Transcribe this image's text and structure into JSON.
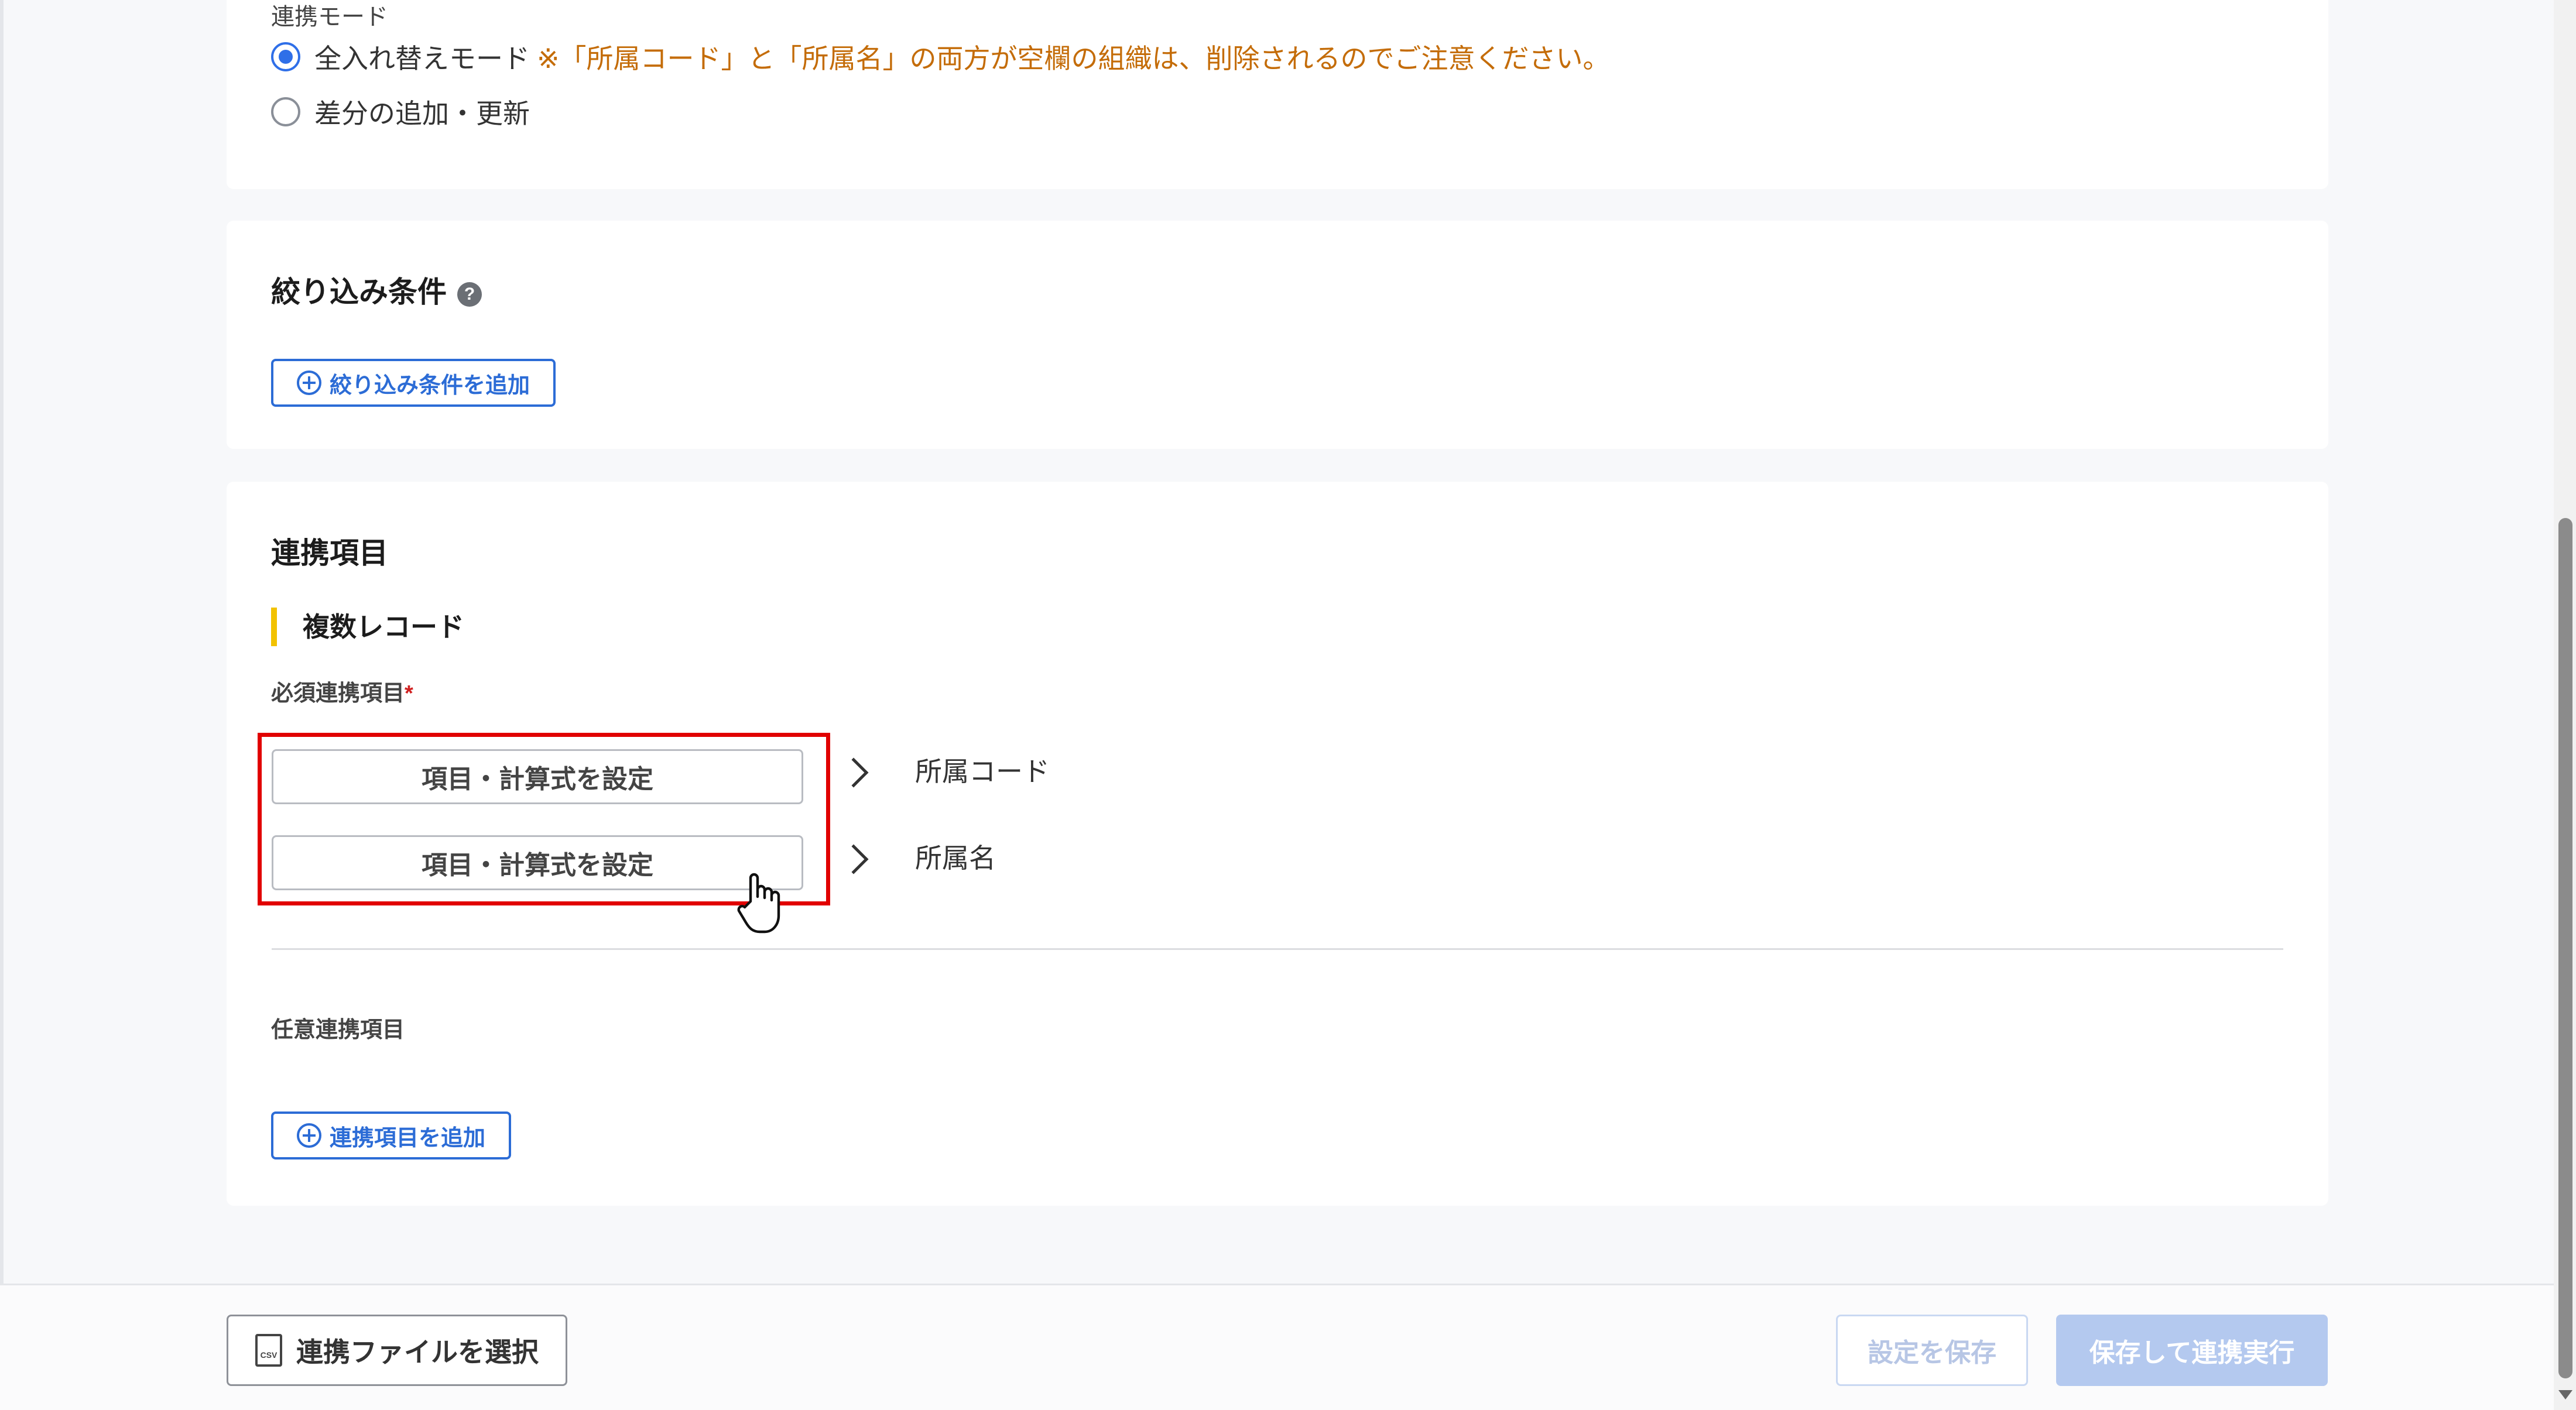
{
  "mode_section": {
    "title": "連携モード",
    "options": [
      {
        "label": "全入れ替えモード",
        "note": "※「所属コード」と「所属名」の両方が空欄の組織は、削除されるのでご注意ください。",
        "checked": true
      },
      {
        "label": "差分の追加・更新",
        "note": "",
        "checked": false
      }
    ]
  },
  "filter_section": {
    "title": "絞り込み条件",
    "help_icon": "?",
    "add_button": "絞り込み条件を追加"
  },
  "items_section": {
    "title": "連携項目",
    "subheading": "複数レコード",
    "required_label": "必須連携項目",
    "required_mark": "*",
    "required_rows": [
      {
        "button": "項目・計算式を設定",
        "target": "所属コード"
      },
      {
        "button": "項目・計算式を設定",
        "target": "所属名"
      }
    ],
    "optional_label": "任意連携項目",
    "add_button": "連携項目を追加"
  },
  "footer": {
    "select_file_button": "連携ファイルを選択",
    "csv_icon_text": "CSV",
    "save_button": "設定を保存",
    "save_run_button": "保存して連携実行"
  },
  "colors": {
    "primary": "#2c6cd6",
    "warning": "#c46c08",
    "highlight": "#e10000",
    "accent_bar": "#f2c200"
  }
}
